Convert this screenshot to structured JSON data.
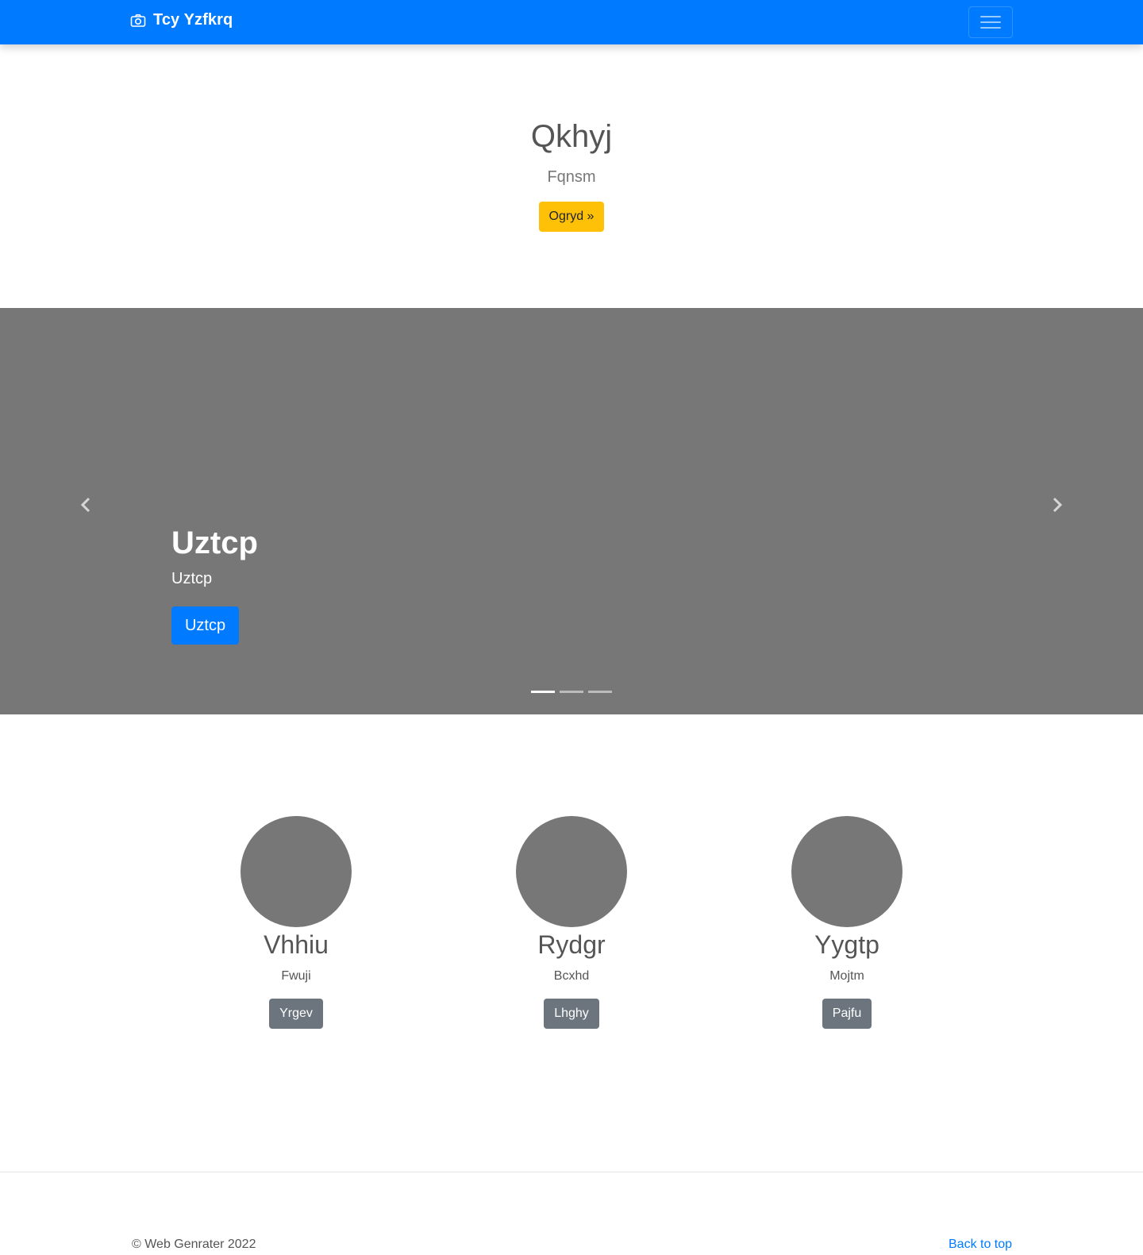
{
  "navbar": {
    "brand_icon": "camera-icon",
    "brand": "Tcy Yzfkrq",
    "toggler_icon": "hamburger-menu-icon",
    "accent_color": "#007bff"
  },
  "hero": {
    "title": "Qkhyj",
    "lead": "Fqnsm",
    "button_label": "Ogryd »",
    "button_color": "#ffc107"
  },
  "carousel": {
    "prev_icon": "chevron-left-icon",
    "next_icon": "chevron-right-icon",
    "background_color": "#777777",
    "slide": {
      "title": "Uztcp",
      "text": "Uztcp",
      "button_label": "Uztcp"
    },
    "slide_count": 3,
    "active_index": 0
  },
  "columns": [
    {
      "heading": "Vhhiu",
      "text": "Fwuji",
      "button_label": "Yrgev"
    },
    {
      "heading": "Rydgr",
      "text": "Bcxhd",
      "button_label": "Lhghy"
    },
    {
      "heading": "Yygtp",
      "text": "Mojtm",
      "button_label": "Pajfu"
    }
  ],
  "footer": {
    "copyright": "© Web Genrater 2022",
    "back_to_top": "Back to top"
  }
}
